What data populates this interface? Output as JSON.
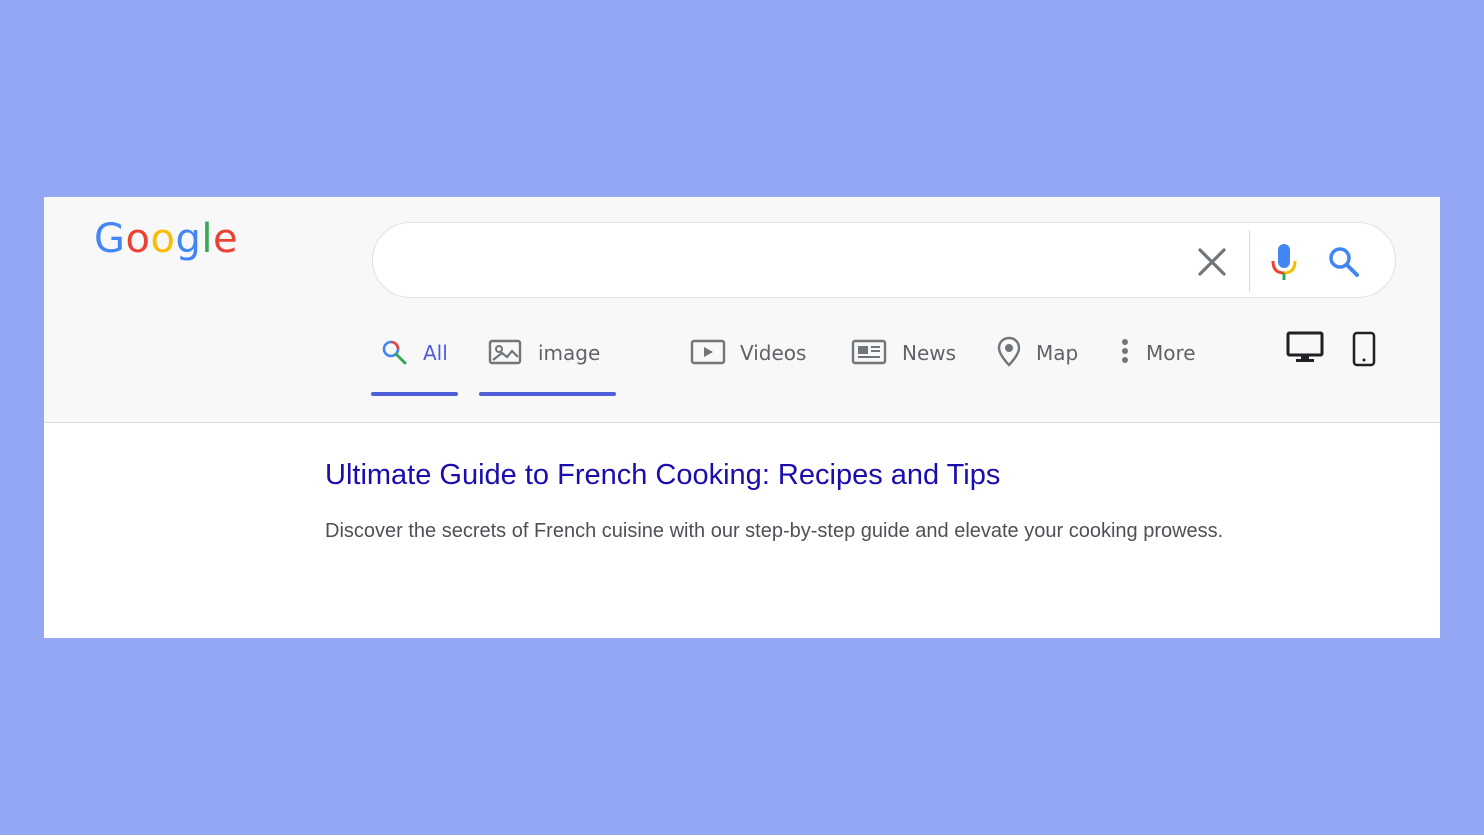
{
  "logo": {
    "letters": [
      {
        "char": "G",
        "color": "#4285f4"
      },
      {
        "char": "o",
        "color": "#ea4335"
      },
      {
        "char": "o",
        "color": "#fbbc05"
      },
      {
        "char": "g",
        "color": "#4285f4"
      },
      {
        "char": "l",
        "color": "#34a853"
      },
      {
        "char": "e",
        "color": "#ea4335"
      }
    ]
  },
  "search": {
    "value": "",
    "placeholder": "",
    "clear_icon": "close-icon",
    "mic_icon": "microphone-icon",
    "search_icon": "search-icon"
  },
  "tabs": [
    {
      "label": "All",
      "icon": "search-icon",
      "active": true
    },
    {
      "label": "image",
      "icon": "image-icon",
      "active": true
    },
    {
      "label": "Videos",
      "icon": "video-icon",
      "active": false
    },
    {
      "label": "News",
      "icon": "news-icon",
      "active": false
    },
    {
      "label": "Map",
      "icon": "map-pin-icon",
      "active": false
    },
    {
      "label": "More",
      "icon": "more-vertical-icon",
      "active": false
    }
  ],
  "device_toggle": {
    "desktop_icon": "desktop-icon",
    "mobile_icon": "mobile-icon"
  },
  "result": {
    "title": "Ultimate Guide to French Cooking: Recipes and Tips",
    "snippet": "Discover the secrets of French cuisine with our step-by-step guide and elevate your cooking prowess."
  },
  "colors": {
    "background": "#94a7f5",
    "header_bg": "#f8f8f8",
    "active_tab": "#4f5fd8",
    "result_title": "#1a0dab",
    "snippet": "#4d5156"
  }
}
